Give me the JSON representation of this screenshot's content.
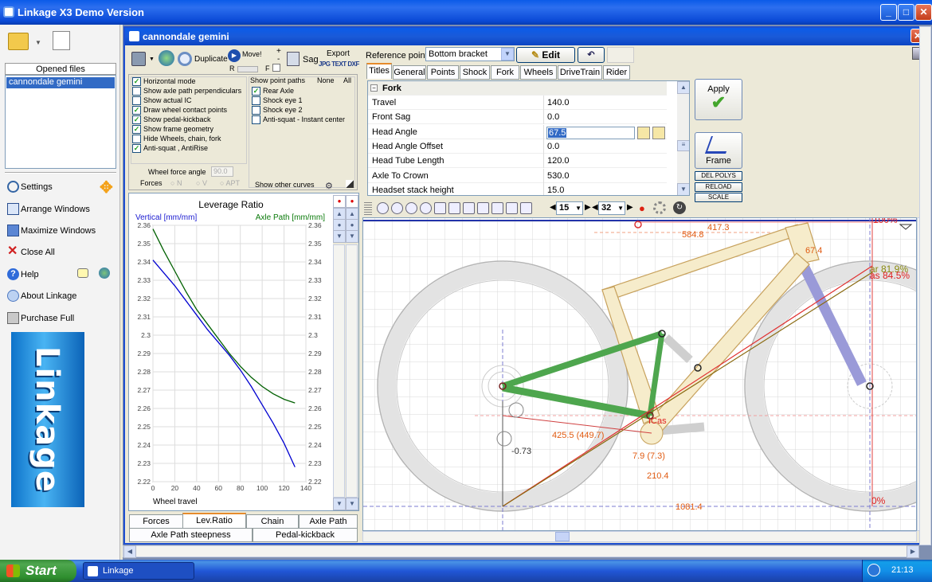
{
  "app": {
    "title": "Linkage X3 Demo Version"
  },
  "left": {
    "opened_files_label": "Opened files",
    "files": [
      "cannondale gemini"
    ],
    "menu": [
      {
        "label": "Settings",
        "icon": "settings-icon"
      },
      {
        "label": "Arrange Windows",
        "icon": "arrange-windows-icon"
      },
      {
        "label": "Maximize Windows",
        "icon": "maximize-windows-icon"
      },
      {
        "label": "Close All",
        "icon": "close-all-icon"
      },
      {
        "label": "Help",
        "icon": "help-icon"
      },
      {
        "label": "About Linkage",
        "icon": "about-icon"
      },
      {
        "label": "Purchase Full",
        "icon": "purchase-icon"
      }
    ],
    "logo_text": "Linkage"
  },
  "doc": {
    "title": "cannondale gemini",
    "toolbar": {
      "duplicate": "Duplicate",
      "move": "Move!",
      "sag": "Sag",
      "export": "Export",
      "export_formats": "JPG TEXT DXF",
      "r": "R",
      "f": "F",
      "plus": "+",
      "minus": "-"
    },
    "options": [
      {
        "label": "Horizontal mode",
        "checked": true
      },
      {
        "label": "Show axle path perpendiculars",
        "checked": false
      },
      {
        "label": "Show actual IC",
        "checked": false
      },
      {
        "label": "Draw wheel contact points",
        "checked": true
      },
      {
        "label": "Show pedal-kickback",
        "checked": true
      },
      {
        "label": "Show frame geometry",
        "checked": true
      },
      {
        "label": "Hide Wheels, chain, fork",
        "checked": false
      },
      {
        "label": "Anti-squat , AntiRise",
        "checked": true
      }
    ],
    "point_paths": {
      "title": "Show point paths",
      "none": "None",
      "all": "All",
      "items": [
        {
          "label": "Rear Axle",
          "checked": true
        },
        {
          "label": "Shock eye 1",
          "checked": false
        },
        {
          "label": "Shock eye 2",
          "checked": false
        },
        {
          "label": "Anti-squat - Instant center",
          "checked": false
        }
      ],
      "other_curves": "Show other curves"
    },
    "wheel_force_angle_label": "Wheel force angle",
    "wheel_force_angle_value": "90.0",
    "forces": {
      "label": "Forces",
      "options": [
        "N",
        "V",
        "APT"
      ]
    },
    "reference_point_label": "Reference point",
    "reference_point_value": "Bottom bracket",
    "edit_label": "Edit",
    "undo_icon": "undo-icon",
    "tabs": [
      "Titles",
      "General",
      "Points",
      "Shock",
      "Fork",
      "Wheels",
      "DriveTrain",
      "Rider"
    ],
    "group": "Fork",
    "properties": [
      {
        "k": "Travel",
        "v": "140.0"
      },
      {
        "k": "Front Sag",
        "v": "0.0"
      },
      {
        "k": "Head Angle",
        "v": "67.5"
      },
      {
        "k": "Head Angle Offset",
        "v": "0.0"
      },
      {
        "k": "Head Tube Length",
        "v": "120.0"
      },
      {
        "k": "Axle To Crown",
        "v": "530.0"
      },
      {
        "k": "Headset stack height",
        "v": "15.0"
      }
    ],
    "apply_label": "Apply",
    "frame_label": "Frame",
    "small_buttons": [
      "DEL POLYS",
      "RELOAD",
      "SCALE"
    ],
    "zoom_a": "15",
    "zoom_b": "32",
    "bottom_tabs": [
      "Forces",
      "Lev.Ratio",
      "Chain",
      "Axle Path",
      "Axle Path steepness",
      "Pedal-kickback"
    ]
  },
  "chart_data": {
    "type": "line",
    "title": "Leverage Ratio",
    "ylabel": "Vertical [mm/mm]",
    "ylabel_right": "Axle Path [mm/mm]",
    "xlabel": "Wheel travel",
    "xlim": [
      0,
      140
    ],
    "ylim": [
      2.22,
      2.36
    ],
    "xticks": [
      "0",
      "20",
      "40",
      "60",
      "80",
      "100",
      "120",
      "140"
    ],
    "yticks": [
      "2.36",
      "2.35",
      "2.34",
      "2.33",
      "2.32",
      "2.31",
      "2.3",
      "2.29",
      "2.28",
      "2.27",
      "2.26",
      "2.25",
      "2.24",
      "2.23",
      "2.22"
    ],
    "grid": true,
    "series": [
      {
        "name": "Vertical [mm/mm]",
        "color": "#0000d0",
        "x": [
          0,
          10,
          20,
          30,
          40,
          50,
          60,
          70,
          80,
          90,
          100,
          110,
          120,
          130
        ],
        "y": [
          2.341,
          2.334,
          2.327,
          2.319,
          2.311,
          2.303,
          2.296,
          2.289,
          2.281,
          2.272,
          2.262,
          2.252,
          2.241,
          2.228
        ]
      },
      {
        "name": "Axle Path [mm/mm]",
        "color": "#006000",
        "x": [
          0,
          10,
          20,
          30,
          40,
          50,
          60,
          70,
          80,
          90,
          100,
          110,
          120,
          130
        ],
        "y": [
          2.358,
          2.346,
          2.335,
          2.324,
          2.314,
          2.306,
          2.298,
          2.29,
          2.283,
          2.277,
          2.272,
          2.268,
          2.265,
          2.263
        ]
      }
    ]
  },
  "drawing": {
    "labels": [
      "417.3",
      "584.8",
      "67.4",
      "425.5 (449.7)",
      "-0.73",
      "7.9 (7.3)",
      "210.4",
      "1081.4",
      "100%",
      "0%",
      "ar 81.9%",
      "as 84.5%",
      "ICas"
    ]
  },
  "taskbar": {
    "start": "Start",
    "task": "Linkage",
    "lang": "DE",
    "time": "21:13"
  }
}
